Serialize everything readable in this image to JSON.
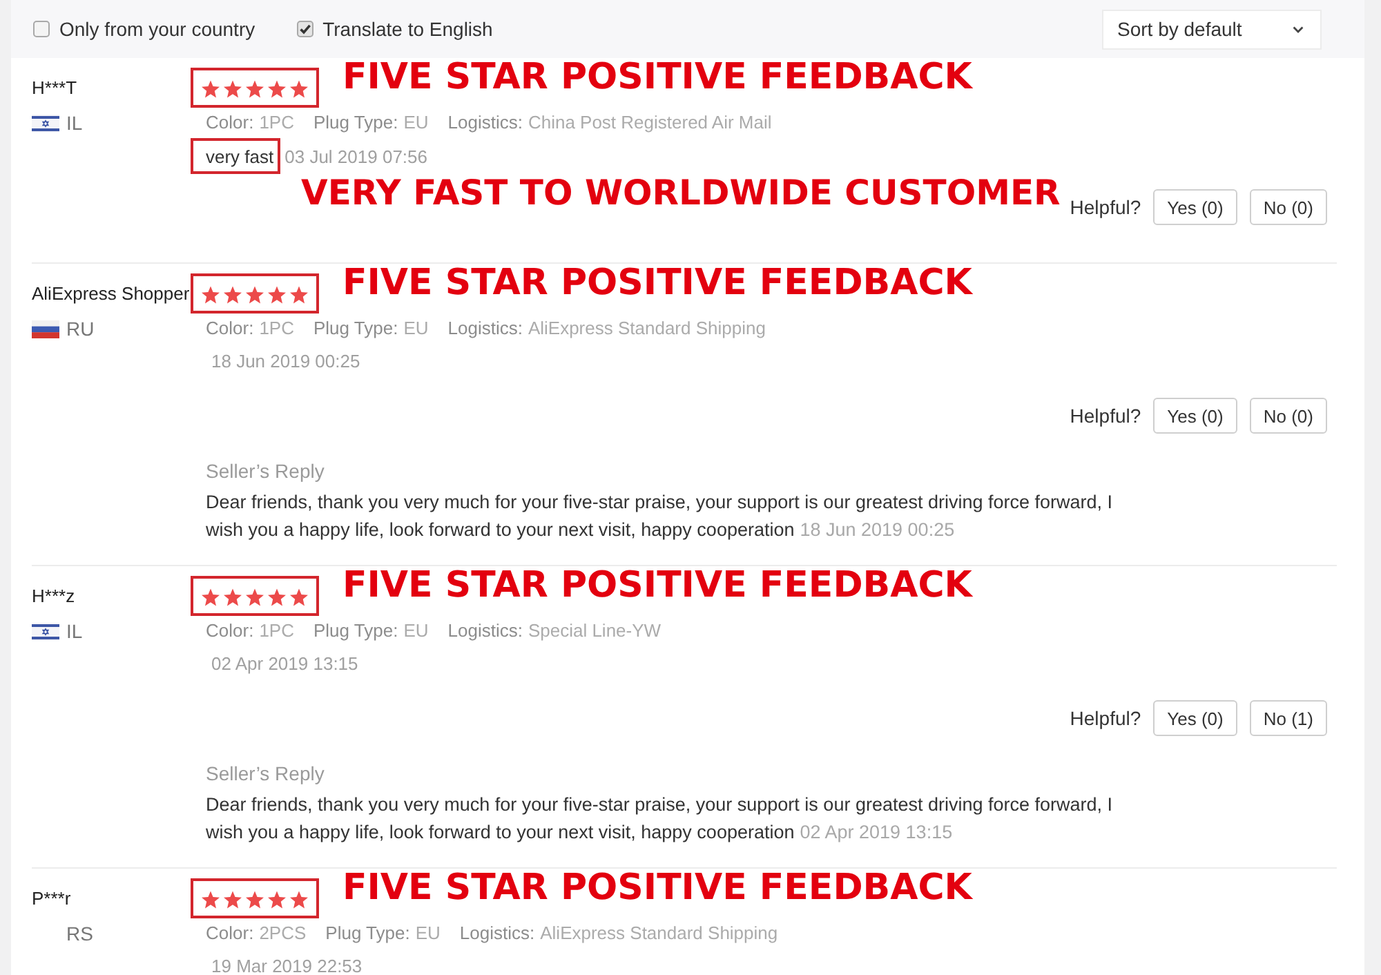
{
  "filters": [
    {
      "label": "Only from your country",
      "checked": false
    },
    {
      "label": "Translate to English",
      "checked": true
    }
  ],
  "sort": {
    "value": "Sort by default"
  },
  "reviews": [
    {
      "name": "H***T",
      "flag": {
        "kind": "il"
      },
      "country": "IL",
      "stars": 5,
      "caption": "FIVE STAR POSITIVE FEEDBACK",
      "attributes": [
        {
          "label": "Color:",
          "value": "1PC"
        },
        {
          "label": "Plug Type:",
          "value": "EU"
        },
        {
          "label": "Logistics:",
          "value": "China Post Registered Air Mail"
        }
      ],
      "comment": "very fast",
      "date": "03 Jul 2019 07:56",
      "comment_caption": "VERY FAST TO WORLDWIDE CUSTOMER",
      "helpful": {
        "label": "Helpful?",
        "yes": "Yes (0)",
        "no": "No (0)"
      }
    },
    {
      "name": "AliExpress Shopper",
      "flag": {
        "kind": "ru"
      },
      "country": "RU",
      "stars": 5,
      "caption": "FIVE STAR POSITIVE FEEDBACK",
      "attributes": [
        {
          "label": "Color:",
          "value": "1PC"
        },
        {
          "label": "Plug Type:",
          "value": "EU"
        },
        {
          "label": "Logistics:",
          "value": "AliExpress Standard Shipping"
        }
      ],
      "date": "18 Jun 2019 00:25",
      "helpful": {
        "label": "Helpful?",
        "yes": "Yes (0)",
        "no": "No (0)"
      },
      "seller_reply": {
        "title": "Seller’s Reply",
        "text": "Dear friends, thank you very much for your five-star praise, your support is our greatest driving force forward, I wish you a happy life, look forward to your next visit, happy cooperation",
        "date": "18 Jun 2019 00:25"
      }
    },
    {
      "name": "H***z",
      "flag": {
        "kind": "il"
      },
      "country": "IL",
      "stars": 5,
      "caption": "FIVE STAR POSITIVE FEEDBACK",
      "attributes": [
        {
          "label": "Color:",
          "value": "1PC"
        },
        {
          "label": "Plug Type:",
          "value": "EU"
        },
        {
          "label": "Logistics:",
          "value": "Special Line-YW"
        }
      ],
      "date": "02 Apr 2019 13:15",
      "helpful": {
        "label": "Helpful?",
        "yes": "Yes (0)",
        "no": "No (1)"
      },
      "seller_reply": {
        "title": "Seller’s Reply",
        "text": "Dear friends, thank you very much for your five-star praise, your support is our greatest driving force forward, I wish you a happy life, look forward to your next visit, happy cooperation",
        "date": "02 Apr 2019 13:15"
      }
    },
    {
      "name": "P***r",
      "country": "RS",
      "stars": 5,
      "caption": "FIVE STAR POSITIVE FEEDBACK",
      "attributes": [
        {
          "label": "Color:",
          "value": "2PCS"
        },
        {
          "label": "Plug Type:",
          "value": "EU"
        },
        {
          "label": "Logistics:",
          "value": "AliExpress Standard Shipping"
        }
      ],
      "date": "19 Mar 2019 22:53"
    }
  ]
}
